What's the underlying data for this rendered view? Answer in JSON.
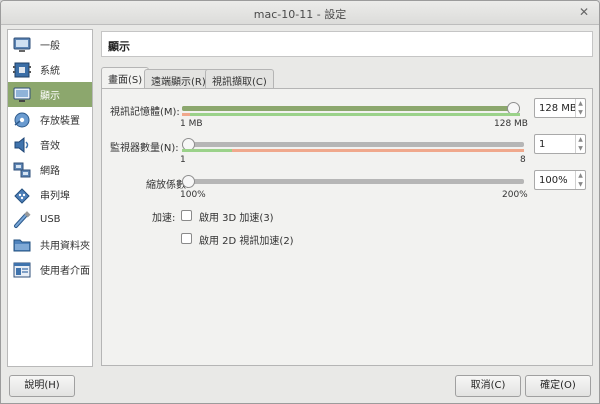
{
  "window": {
    "title": "mac-10-11 - 設定"
  },
  "sidebar": {
    "items": [
      {
        "label": "一般"
      },
      {
        "label": "系統"
      },
      {
        "label": "顯示"
      },
      {
        "label": "存放裝置"
      },
      {
        "label": "音效"
      },
      {
        "label": "網路"
      },
      {
        "label": "串列埠"
      },
      {
        "label": "USB"
      },
      {
        "label": "共用資料夾"
      },
      {
        "label": "使用者介面"
      }
    ],
    "active_index": 2
  },
  "header": {
    "title": "顯示"
  },
  "tabs": [
    {
      "label": "畫面(S)"
    },
    {
      "label": "遠端顯示(R)"
    },
    {
      "label": "視訊擷取(C)"
    }
  ],
  "screen": {
    "video_memory": {
      "label": "視訊記憶體(M):",
      "min_label": "1 MB",
      "max_label": "128 MB",
      "value": "128 MB",
      "fraction": 1.0
    },
    "monitors": {
      "label": "監視器數量(N):",
      "min_label": "1",
      "max_label": "8",
      "value": "1",
      "fraction": 0.0
    },
    "scale": {
      "label": "縮放係數:",
      "min_label": "100%",
      "max_label": "200%",
      "value": "100%",
      "fraction": 0.0
    },
    "acceleration": {
      "label": "加速:",
      "enable_3d": {
        "label": "啟用 3D 加速(3)",
        "checked": false
      },
      "enable_2d": {
        "label": "啟用 2D 視訊加速(2)",
        "checked": false
      }
    }
  },
  "buttons": {
    "help": "說明(H)",
    "cancel": "取消(C)",
    "ok": "確定(O)"
  },
  "colors": {
    "accent": "#8ca76d",
    "range_ok": "#9bd28a",
    "range_warn": "#f0a88c"
  }
}
